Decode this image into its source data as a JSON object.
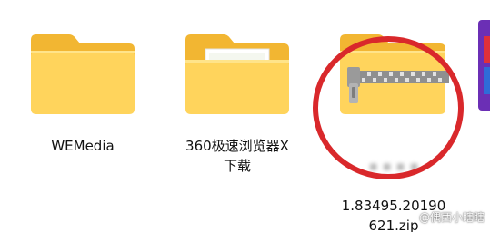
{
  "files": [
    {
      "name": "WEMedia",
      "type": "folder",
      "icon": "folder-icon"
    },
    {
      "name": "360极速浏览器X\n下载",
      "type": "folder",
      "icon": "folder-with-document-icon"
    },
    {
      "name_visible": "1.83495.20190\n621.zip",
      "type": "zip",
      "icon": "zip-folder-icon"
    }
  ],
  "annotation": {
    "shape": "circle",
    "color": "#d9282b",
    "target": "zip-file"
  },
  "watermark": {
    "text": "@偶西小瞎瞎",
    "logo": "toutiao-logo"
  },
  "colors": {
    "folder_back": "#f2b632",
    "folder_front": "#ffd45c",
    "zipper": "#9a9a9a",
    "circle": "#d9282b"
  }
}
